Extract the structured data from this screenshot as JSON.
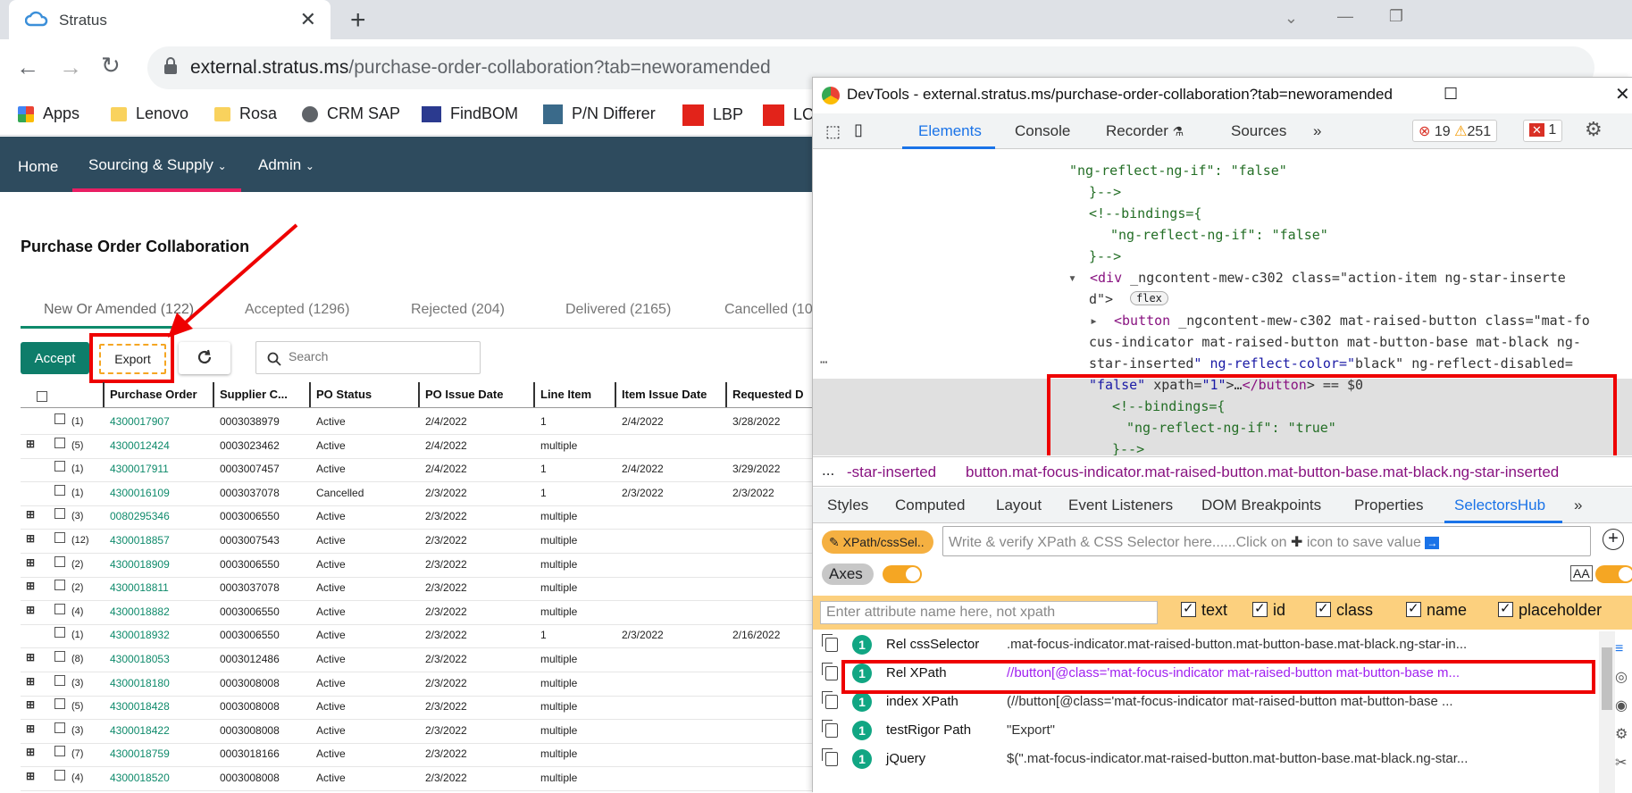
{
  "browser": {
    "tab_title": "Stratus",
    "url_domain": "external.stratus.ms",
    "url_path": "/purchase-order-collaboration?tab=neworamended",
    "bookmarks": [
      "Apps",
      "Lenovo",
      "Rosa",
      "CRM SAP",
      "FindBOM",
      "P/N Differer",
      "LBP",
      "LC"
    ]
  },
  "app": {
    "nav": [
      "Home",
      "Sourcing & Supply",
      "Admin"
    ],
    "page_title": "Purchase Order Collaboration",
    "tabs": [
      "New Or Amended (122)",
      "Accepted (1296)",
      "Rejected (204)",
      "Delivered (2165)",
      "Cancelled (10"
    ],
    "accept_label": "Accept",
    "export_label": "Export",
    "search_placeholder": "Search",
    "columns": [
      "Purchase Order",
      "Supplier C...",
      "PO Status",
      "PO Issue Date",
      "Line Item",
      "Item Issue Date",
      "Requested D"
    ],
    "rows": [
      {
        "count": "(1)",
        "expand": false,
        "po": "4300017907",
        "supplier": "0003038979",
        "status": "Active",
        "issue": "2/4/2022",
        "line": "1",
        "item_issue": "2/4/2022",
        "req": "3/28/2022"
      },
      {
        "count": "(5)",
        "expand": true,
        "po": "4300012424",
        "supplier": "0003023462",
        "status": "Active",
        "issue": "2/4/2022",
        "line": "multiple",
        "item_issue": "",
        "req": ""
      },
      {
        "count": "(1)",
        "expand": false,
        "po": "4300017911",
        "supplier": "0003007457",
        "status": "Active",
        "issue": "2/4/2022",
        "line": "1",
        "item_issue": "2/4/2022",
        "req": "3/29/2022"
      },
      {
        "count": "(1)",
        "expand": false,
        "po": "4300016109",
        "supplier": "0003037078",
        "status": "Cancelled",
        "issue": "2/3/2022",
        "line": "1",
        "item_issue": "2/3/2022",
        "req": "2/3/2022"
      },
      {
        "count": "(3)",
        "expand": true,
        "po": "0080295346",
        "supplier": "0003006550",
        "status": "Active",
        "issue": "2/3/2022",
        "line": "multiple",
        "item_issue": "",
        "req": ""
      },
      {
        "count": "(12)",
        "expand": true,
        "po": "4300018857",
        "supplier": "0003007543",
        "status": "Active",
        "issue": "2/3/2022",
        "line": "multiple",
        "item_issue": "",
        "req": ""
      },
      {
        "count": "(2)",
        "expand": true,
        "po": "4300018909",
        "supplier": "0003006550",
        "status": "Active",
        "issue": "2/3/2022",
        "line": "multiple",
        "item_issue": "",
        "req": ""
      },
      {
        "count": "(2)",
        "expand": true,
        "po": "4300018811",
        "supplier": "0003037078",
        "status": "Active",
        "issue": "2/3/2022",
        "line": "multiple",
        "item_issue": "",
        "req": ""
      },
      {
        "count": "(4)",
        "expand": true,
        "po": "4300018882",
        "supplier": "0003006550",
        "status": "Active",
        "issue": "2/3/2022",
        "line": "multiple",
        "item_issue": "",
        "req": ""
      },
      {
        "count": "(1)",
        "expand": false,
        "po": "4300018932",
        "supplier": "0003006550",
        "status": "Active",
        "issue": "2/3/2022",
        "line": "1",
        "item_issue": "2/3/2022",
        "req": "2/16/2022"
      },
      {
        "count": "(8)",
        "expand": true,
        "po": "4300018053",
        "supplier": "0003012486",
        "status": "Active",
        "issue": "2/3/2022",
        "line": "multiple",
        "item_issue": "",
        "req": ""
      },
      {
        "count": "(3)",
        "expand": true,
        "po": "4300018180",
        "supplier": "0003008008",
        "status": "Active",
        "issue": "2/3/2022",
        "line": "multiple",
        "item_issue": "",
        "req": ""
      },
      {
        "count": "(5)",
        "expand": true,
        "po": "4300018428",
        "supplier": "0003008008",
        "status": "Active",
        "issue": "2/3/2022",
        "line": "multiple",
        "item_issue": "",
        "req": ""
      },
      {
        "count": "(3)",
        "expand": true,
        "po": "4300018422",
        "supplier": "0003008008",
        "status": "Active",
        "issue": "2/3/2022",
        "line": "multiple",
        "item_issue": "",
        "req": ""
      },
      {
        "count": "(7)",
        "expand": true,
        "po": "4300018759",
        "supplier": "0003018166",
        "status": "Active",
        "issue": "2/3/2022",
        "line": "multiple",
        "item_issue": "",
        "req": ""
      },
      {
        "count": "(4)",
        "expand": true,
        "po": "4300018520",
        "supplier": "0003008008",
        "status": "Active",
        "issue": "2/3/2022",
        "line": "multiple",
        "item_issue": "",
        "req": ""
      }
    ]
  },
  "devtools": {
    "title": "DevTools - external.stratus.ms/purchase-order-collaboration?tab=neworamended",
    "tabs": [
      "Elements",
      "Console",
      "Recorder",
      "Sources",
      "»"
    ],
    "errors": "19",
    "warnings": "251",
    "issues": "1",
    "code_lines": [
      "\"ng-reflect-ng-if\": \"false\"",
      "}-->",
      "<!--bindings={",
      "\"ng-reflect-ng-if\": \"false\"",
      "}-->",
      "<div _ngcontent-mew-c302 class=\"action-item ng-star-inserte",
      "d\">",
      "<button _ngcontent-mew-c302 mat-raised-button class=\"mat-fo",
      "cus-indicator mat-raised-button mat-button-base mat-black ng-",
      "star-inserted\" ng-reflect-color=\"black\" ng-reflect-disabled=",
      "\"false\" xpath=\"1\">…</button> == $0",
      "<!--bindings={",
      "\"ng-reflect-ng-if\": \"true\"",
      "}-->"
    ],
    "flex_badge": "flex",
    "breadcrumb_prefix": "...",
    "breadcrumb_1": "-star-inserted",
    "breadcrumb_2": "button.mat-focus-indicator.mat-raised-button.mat-button-base.mat-black.ng-star-inserted",
    "panel_tabs": [
      "Styles",
      "Computed",
      "Layout",
      "Event Listeners",
      "DOM Breakpoints",
      "Properties",
      "SelectorsHub",
      "»"
    ],
    "xpath_btn": "XPath/cssSel..",
    "xpath_placeholder": "Write & verify XPath & CSS Selector here......Click on",
    "xpath_placeholder_end": "icon to save value",
    "axes_label": "Axes",
    "attr_placeholder": "Enter attribute name here, not xpath",
    "checks": [
      "text",
      "id",
      "class",
      "name",
      "placeholder"
    ],
    "results": [
      {
        "count": "1",
        "name": "Rel cssSelector",
        "value": ".mat-focus-indicator.mat-raised-button.mat-button-base.mat-black.ng-star-in..."
      },
      {
        "count": "1",
        "name": "Rel XPath",
        "value": "//button[@class='mat-focus-indicator mat-raised-button mat-button-base m..."
      },
      {
        "count": "1",
        "name": "index XPath",
        "value": "(//button[@class='mat-focus-indicator mat-raised-button mat-button-base ..."
      },
      {
        "count": "1",
        "name": "testRigor Path",
        "value": "\"Export\""
      },
      {
        "count": "1",
        "name": "jQuery",
        "value": "$(\".mat-focus-indicator.mat-raised-button.mat-button-base.mat-black.ng-star..."
      }
    ]
  }
}
